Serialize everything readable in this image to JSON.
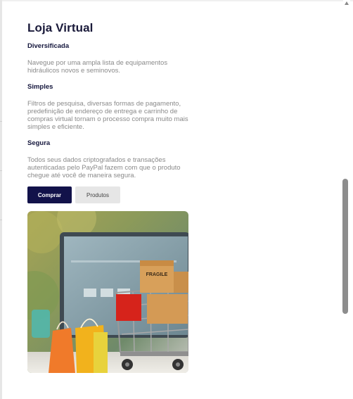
{
  "page": {
    "title": "Loja Virtual"
  },
  "sections": [
    {
      "heading": "Diversificada",
      "text": "Navegue por uma ampla lista de equipamentos hidráulicos novos e seminovos."
    },
    {
      "heading": "Simples",
      "text": "Filtros de pesquisa, diversas formas de pagamento, predefinição de endereço de entrega e carrinho de compras virtual tornam o processo compra muito mais simples e eficiente."
    },
    {
      "heading": "Segura",
      "text": "Todos seus dados criptografados e transações autenticadas pelo PayPal fazem com que o produto chegue até você de maneira segura."
    }
  ],
  "buttons": {
    "primary_label": "Comprar",
    "secondary_label": "Produtos"
  },
  "image": {
    "box_label": "FRAGILE",
    "icons": [
      "shopping-bags-icon",
      "shopping-cart-icon",
      "laptop-icon",
      "package-box-icon"
    ]
  },
  "colors": {
    "title": "#1a1a3a",
    "heading": "#14163c",
    "body_text": "#8a8a8a",
    "primary_button": "#12124a",
    "secondary_button": "#e6e6e6",
    "scrollbar_thumb": "#8d8d8d"
  }
}
